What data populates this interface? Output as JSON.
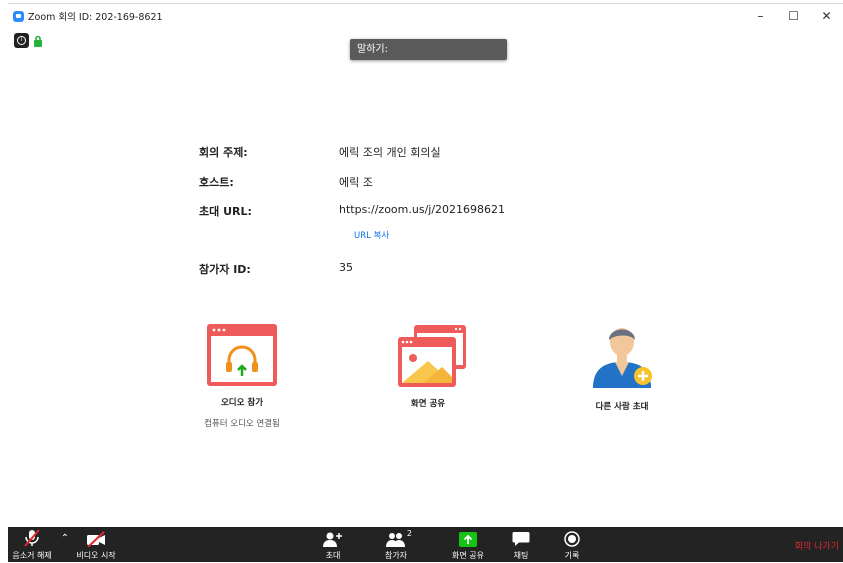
{
  "window": {
    "title": "Zoom 회의 ID: 202-169-8621"
  },
  "speaking_label": "말하기:",
  "meeting": {
    "topic_label": "회의 주제:",
    "topic_value": "에릭 조의 개인 회의실",
    "host_label": "호스트:",
    "host_value": "에릭 조",
    "url_label": "초대 URL:",
    "url_value": "https://zoom.us/j/2021698621",
    "copy_url": "URL 복사",
    "participant_label": "참가자 ID:",
    "participant_value": "35"
  },
  "actions": {
    "join_audio": "오디오 참가",
    "join_audio_sub": "컴퓨터 오디오 연결됨",
    "share_screen": "화면 공유",
    "invite_others": "다른 사람 초대"
  },
  "toolbar": {
    "unmute": "음소거 해제",
    "start_video": "비디오 시작",
    "invite": "초대",
    "participants": "참가자",
    "participants_count": "2",
    "share": "화면 공유",
    "chat": "채팅",
    "record": "기록",
    "leave": "회의 나가기"
  },
  "colors": {
    "accent": "#2d8cff",
    "share_green": "#16c216",
    "leave_red": "#e0282e",
    "icon_red": "#ef5a5a"
  }
}
